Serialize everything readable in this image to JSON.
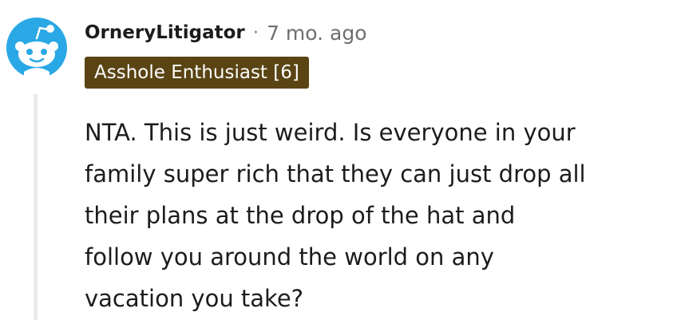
{
  "comment": {
    "author": "OrneryLitigator",
    "separator": "·",
    "timestamp": "7 mo. ago",
    "flair": "Asshole Enthusiast [6]",
    "avatar_icon": "snoo-avatar-icon",
    "body_lines": [
      "NTA. This is just weird. Is everyone in your",
      "family super rich that they can just drop all",
      "their plans at the drop of the hat and",
      "follow you around the world on any",
      "vacation you take?"
    ]
  },
  "colors": {
    "avatar_bg": "#2aa8e6",
    "flair_bg": "#5a4414",
    "thread_line": "#e8eaec"
  }
}
